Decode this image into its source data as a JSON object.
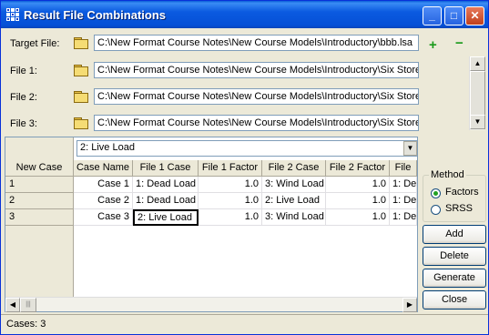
{
  "window": {
    "title": "Result File Combinations"
  },
  "titlebar_buttons": {
    "minimize": "_",
    "maximize": "□",
    "close": "✕"
  },
  "files": {
    "target_label": "Target File:",
    "target_path": "C:\\New Format Course Notes\\New Course Models\\Introductory\\bbb.lsa",
    "add_symbol": "+",
    "remove_symbol": "−",
    "items": [
      {
        "label": "File 1:",
        "path": "C:\\New Format Course Notes\\New Course Models\\Introductory\\Six Store"
      },
      {
        "label": "File 2:",
        "path": "C:\\New Format Course Notes\\New Course Models\\Introductory\\Six Store"
      },
      {
        "label": "File 3:",
        "path": "C:\\New Format Course Notes\\New Course Models\\Introductory\\Six Store"
      }
    ]
  },
  "grid": {
    "combo_value": "2: Live Load",
    "row_header_title": "New Case",
    "columns": [
      "Case Name",
      "File 1 Case",
      "File 1 Factor",
      "File 2 Case",
      "File 2 Factor",
      "File"
    ],
    "rows": [
      {
        "num": "1",
        "cells": [
          "Case 1",
          "1: Dead Load",
          "1.0",
          "3: Wind Load",
          "1.0",
          "1: Dea"
        ]
      },
      {
        "num": "2",
        "cells": [
          "Case 2",
          "1: Dead Load",
          "1.0",
          "2: Live Load",
          "1.0",
          "1: Dea"
        ]
      },
      {
        "num": "3",
        "cells": [
          "Case 3",
          "2: Live Load",
          "1.0",
          "3: Wind Load",
          "1.0",
          "1: Dea"
        ]
      }
    ]
  },
  "method": {
    "legend": "Method",
    "options": [
      "Factors",
      "SRSS"
    ],
    "selected": "Factors"
  },
  "actions": {
    "add": "Add",
    "delete": "Delete",
    "generate": "Generate",
    "close": "Close"
  },
  "status": {
    "text": "Cases: 3"
  }
}
